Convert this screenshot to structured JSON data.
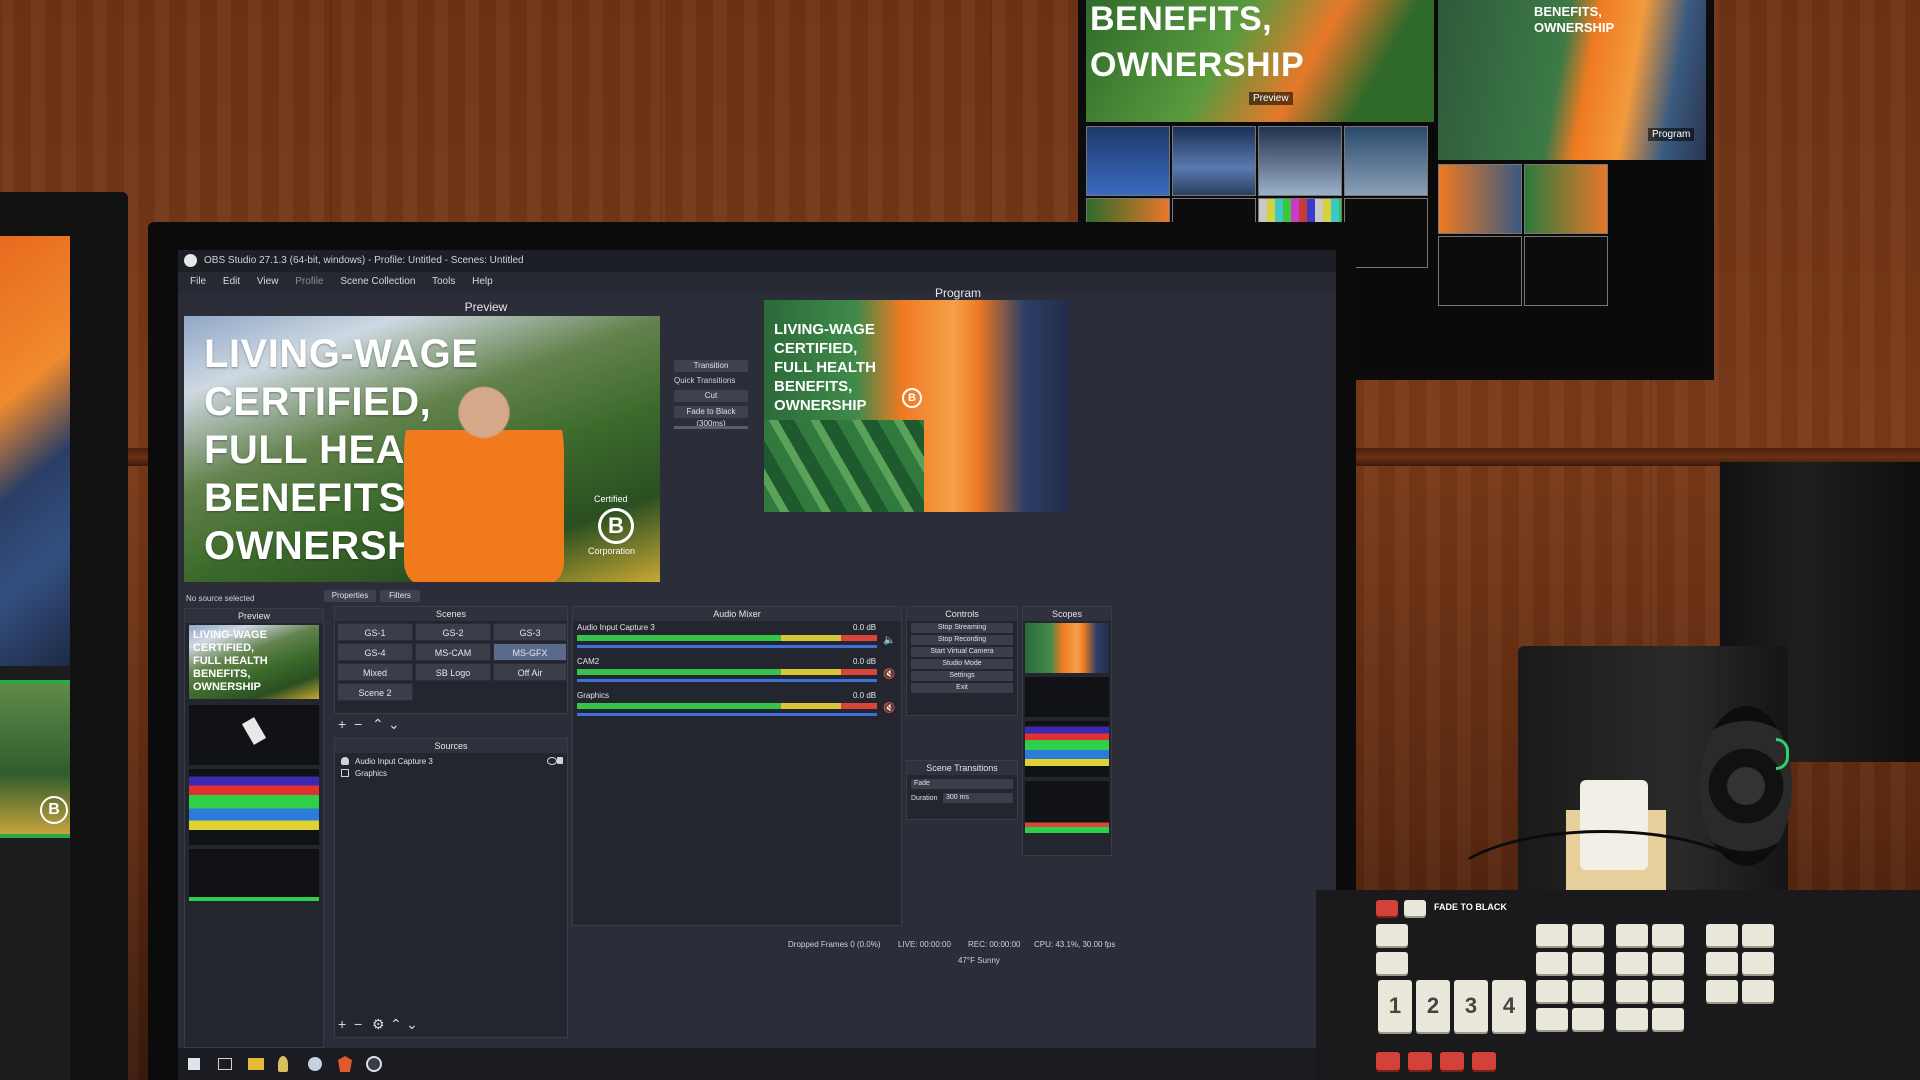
{
  "window": {
    "title": "OBS Studio 27.1.3 (64-bit, windows) - Profile: Untitled - Scenes: Untitled"
  },
  "menu": [
    "File",
    "Edit",
    "View",
    "Profile",
    "Scene Collection",
    "Tools",
    "Help"
  ],
  "panes": {
    "preview_label": "Preview",
    "program_label": "Program"
  },
  "slide": {
    "headline_lines": [
      "LIVING-WAGE",
      "CERTIFIED,",
      "FULL HEALTH",
      "BENEFITS,",
      "OWNERSHIP"
    ],
    "badge_top": "Certified",
    "badge_letter": "B",
    "badge_bottom": "Corporation"
  },
  "transitions": {
    "transition_button": "Transition",
    "quick_label": "Quick Transitions",
    "cut": "Cut",
    "fade": "Fade to Black (300ms)"
  },
  "sources_toolbar": {
    "no_source": "No source selected",
    "properties": "Properties",
    "filters": "Filters"
  },
  "mini_preview": {
    "title": "Preview"
  },
  "scenes": {
    "title": "Scenes",
    "items": [
      "GS-1",
      "GS-2",
      "GS-3",
      "GS-4",
      "MS-CAM",
      "MS-GFX",
      "Mixed",
      "SB Logo",
      "Off Air",
      "Scene 2"
    ]
  },
  "sources": {
    "title": "Sources",
    "items": [
      "Audio Input Capture 3",
      "Graphics"
    ]
  },
  "audio_mixer": {
    "title": "Audio Mixer",
    "channels": [
      {
        "name": "Audio Input Capture 3",
        "level": "0.0 dB"
      },
      {
        "name": "CAM2",
        "level": "0.0 dB"
      },
      {
        "name": "Graphics",
        "level": "0.0 dB"
      }
    ]
  },
  "controls": {
    "title": "Controls",
    "buttons": [
      "Stop Streaming",
      "Stop Recording",
      "Start Virtual Camera",
      "Studio Mode",
      "Settings",
      "Exit"
    ],
    "scene_transitions_title": "Scene Transitions",
    "fade_value": "Fade",
    "duration_label": "Duration",
    "duration_value": "300 ms"
  },
  "scopes": {
    "title": "Scopes"
  },
  "statusbar": {
    "dropped": "Dropped Frames 0 (0.0%)",
    "live": "LIVE: 00:00:00",
    "rec": "REC: 00:00:00",
    "cpu": "CPU: 43.1%, 30.00 fps",
    "weather": "47°F Sunny"
  },
  "multiview": {
    "big_text_lines": [
      "BENEFITS,",
      "OWNERSHIP"
    ],
    "preview_tag": "Preview",
    "program_tag": "Program",
    "small_text_lines": [
      "BENEFITS,",
      "OWNERSHIP"
    ]
  },
  "console": {
    "fade_to_black": "FADE TO BLACK",
    "number_keys": [
      "1",
      "2",
      "3",
      "4"
    ]
  },
  "colors": {
    "obs_bg": "#2b2e38",
    "orange": "#f07a1c",
    "meter_green": "#37c24a",
    "green_led": "#2cd46a"
  }
}
